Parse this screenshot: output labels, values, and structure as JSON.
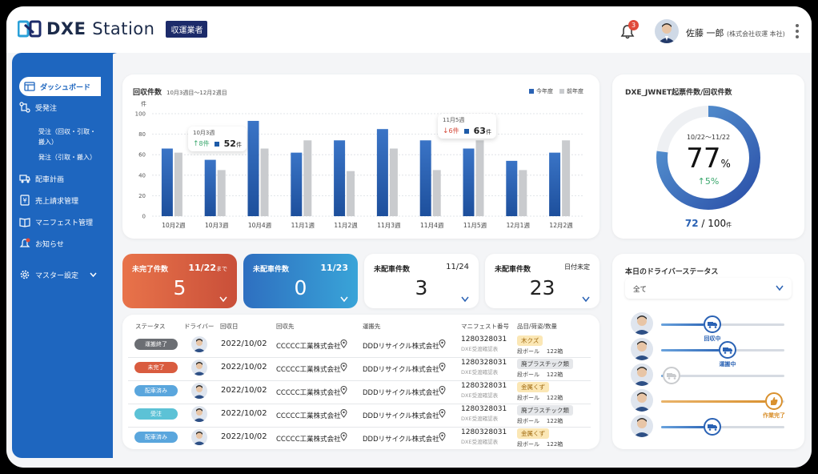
{
  "header": {
    "logo_text_bold": "DXE",
    "logo_text_light": "Station",
    "role_badge": "収運業者",
    "notification_count": "3",
    "user_name": "佐藤 一郎",
    "user_company": "(株式会社収運 本社)"
  },
  "sidebar": {
    "items": [
      {
        "label": "ダッシュボード",
        "icon": "dashboard-icon",
        "active": true
      },
      {
        "label": "受発注",
        "icon": "order-flow-icon"
      },
      {
        "label": "配車計画",
        "icon": "truck-icon"
      },
      {
        "label": "売上請求管理",
        "icon": "billing-icon"
      },
      {
        "label": "マニフェスト管理",
        "icon": "book-icon"
      },
      {
        "label": "お知らせ",
        "icon": "bell-icon"
      },
      {
        "label": "マスター設定",
        "icon": "gear-icon"
      }
    ],
    "sub_items": [
      "受注（回収・引取・",
      "搬入）",
      "発注（引取・搬入）"
    ]
  },
  "collection_chart": {
    "title": "回収件数",
    "period": "10月3週目〜12月2週目",
    "unit": "件",
    "legend": [
      "今年度",
      "前年度"
    ],
    "callout1": {
      "label": "10月3週",
      "diff": "8件",
      "value": "52",
      "unit": "件"
    },
    "callout2": {
      "label": "11月5週",
      "diff": "6件",
      "value": "63",
      "unit": "件"
    }
  },
  "chart_data": {
    "type": "bar",
    "categories": [
      "10月2週",
      "10月3週",
      "10月4週",
      "11月1週",
      "11月2週",
      "11月3週",
      "11月4週",
      "11月5週",
      "12月1週",
      "12月2週"
    ],
    "series": [
      {
        "name": "今年度",
        "values": [
          66,
          55,
          93,
          62,
          74,
          85,
          74,
          66,
          54,
          62
        ]
      },
      {
        "name": "前年度",
        "values": [
          62,
          45,
          66,
          74,
          44,
          66,
          45,
          74,
          45,
          74
        ]
      }
    ],
    "ylim": [
      0,
      100
    ],
    "yticks": [
      0,
      20,
      40,
      60,
      80,
      100
    ],
    "ylabel": "件",
    "colors": {
      "current": "#2a62b4",
      "previous": "#c9cbce"
    },
    "grid": true,
    "legend_position": "top-right"
  },
  "jwnet": {
    "title": "DXE_JWNET起票件数/回収件数",
    "period": "10/22〜11/22",
    "percent": "77",
    "percent_unit": "%",
    "diff": "5%",
    "count": "72",
    "total": "100",
    "unit": "件",
    "ratio": 0.77
  },
  "stats": [
    {
      "label": "未完了件数",
      "date": "11/22",
      "date_suffix": "まで",
      "value": "5",
      "color": "#d95c3f"
    },
    {
      "label": "未配車件数",
      "date": "11/23",
      "value": "0",
      "color": "#2b86c9"
    },
    {
      "label": "未配車件数",
      "date": "11/24",
      "value": "3"
    },
    {
      "label": "未配車件数",
      "date": "日付未定",
      "value": "23"
    }
  ],
  "table": {
    "headers": [
      "ステータス",
      "ドライバー",
      "回収日",
      "回収先",
      "運搬先",
      "マニフェスト番号",
      "品目/荷姿/数量"
    ],
    "rows": [
      {
        "status": "運搬終了",
        "status_color": "#6b6e73",
        "date": "2022/10/02",
        "from": "CCCCC工業株式会社",
        "to": "DDDリサイクル株式会社",
        "manifest": "1280328031",
        "manifest_sub": "DXE受渡確認表",
        "item": "木クズ",
        "item_bg": "#fbe7b5",
        "item_color": "#a06a10",
        "package": "段ボール",
        "qty": "122箱"
      },
      {
        "status": "未完了",
        "status_color": "#d95c3f",
        "date": "2022/10/02",
        "from": "CCCCC工業株式会社",
        "to": "DDDリサイクル株式会社",
        "manifest": "1280328031",
        "manifest_sub": "DXE受渡確認表",
        "item": "廃プラスチック類",
        "item_bg": "#e5e7ea",
        "item_color": "#444",
        "package": "段ボール",
        "qty": "122箱"
      },
      {
        "status": "配車済み",
        "status_color": "#5aa6dd",
        "date": "2022/10/02",
        "from": "CCCCC工業株式会社",
        "to": "DDDリサイクル株式会社",
        "manifest": "1280328031",
        "manifest_sub": "DXE受渡確認表",
        "item": "金属くず",
        "item_bg": "#fbe7b5",
        "item_color": "#a06a10",
        "package": "段ボール",
        "qty": "122箱"
      },
      {
        "status": "受注",
        "status_color": "#5cc2d6",
        "date": "2022/10/02",
        "from": "CCCCC工業株式会社",
        "to": "DDDリサイクル株式会社",
        "manifest": "1280328031",
        "manifest_sub": "DXE受渡確認表",
        "item": "廃プラスチック類",
        "item_bg": "#e5e7ea",
        "item_color": "#444",
        "package": "段ボール",
        "qty": "122箱"
      },
      {
        "status": "配車済み",
        "status_color": "#5aa6dd",
        "date": "2022/10/02",
        "from": "CCCCC工業株式会社",
        "to": "DDDリサイクル株式会社",
        "manifest": "1280328031",
        "manifest_sub": "DXE受渡確認表",
        "item": "金属くず",
        "item_bg": "#fbe7b5",
        "item_color": "#a06a10",
        "package": "段ボール",
        "qty": "122箱"
      }
    ]
  },
  "driver_status": {
    "title": "本日のドライバーステータス",
    "filter": "全て",
    "drivers": [
      {
        "status": "回収中",
        "progress": 0.4,
        "color": "#2a62b4"
      },
      {
        "status": "運搬中",
        "progress": 0.55,
        "color": "#2a62b4"
      },
      {
        "status": "",
        "progress": 0.0,
        "color": "#bbb"
      },
      {
        "status": "作業完了",
        "progress": 1.0,
        "color": "#d9912f"
      },
      {
        "status": "",
        "progress": 0.4,
        "color": "#2a62b4"
      }
    ]
  }
}
